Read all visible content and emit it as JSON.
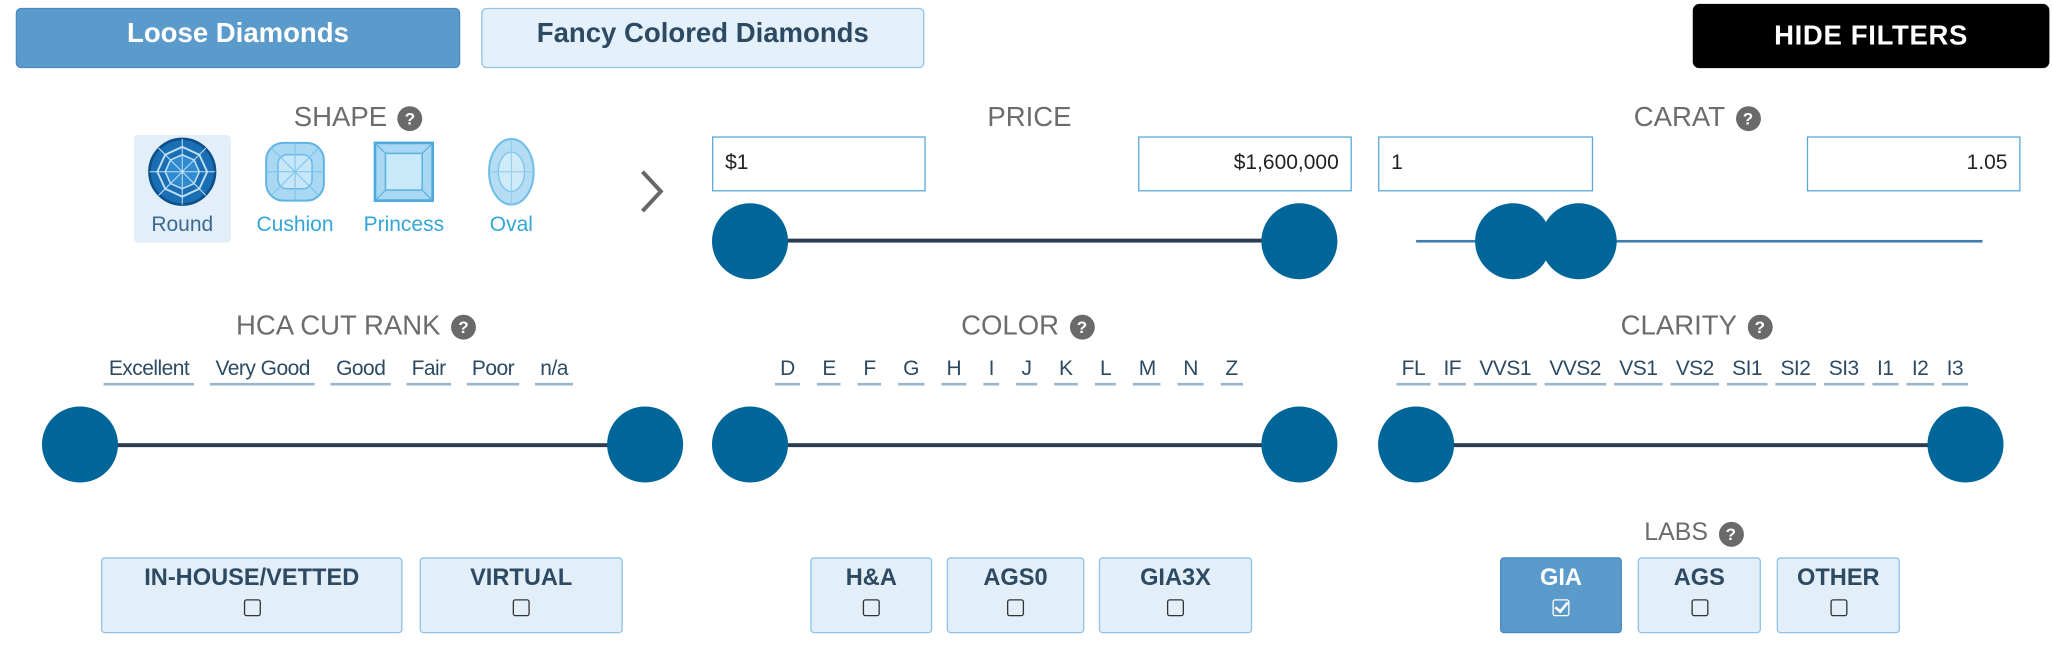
{
  "tabs": {
    "loose": "Loose Diamonds",
    "fancy": "Fancy Colored Diamonds",
    "hide_filters": "HIDE FILTERS"
  },
  "shape": {
    "title": "SHAPE",
    "help": "?",
    "items": [
      {
        "label": "Round",
        "selected": true
      },
      {
        "label": "Cushion",
        "selected": false
      },
      {
        "label": "Princess",
        "selected": false
      },
      {
        "label": "Oval",
        "selected": false
      }
    ]
  },
  "price": {
    "title": "PRICE",
    "min": "$1",
    "max": "$1,600,000"
  },
  "carat": {
    "title": "CARAT",
    "help": "?",
    "min": "1",
    "max": "1.05"
  },
  "cut": {
    "title": "HCA CUT RANK",
    "help": "?",
    "labels": [
      "Excellent",
      "Very Good",
      "Good",
      "Fair",
      "Poor",
      "n/a"
    ]
  },
  "color": {
    "title": "COLOR",
    "help": "?",
    "labels": [
      "D",
      "E",
      "F",
      "G",
      "H",
      "I",
      "J",
      "K",
      "L",
      "M",
      "N",
      "Z"
    ]
  },
  "clarity": {
    "title": "CLARITY",
    "help": "?",
    "labels": [
      "FL",
      "IF",
      "VVS1",
      "VVS2",
      "VS1",
      "VS2",
      "SI1",
      "SI2",
      "SI3",
      "I1",
      "I2",
      "I3"
    ]
  },
  "labs": {
    "title": "LABS",
    "help": "?"
  },
  "checks": {
    "inhouse": {
      "label": "IN-HOUSE/VETTED",
      "checked": false
    },
    "virtual": {
      "label": "VIRTUAL",
      "checked": false
    },
    "ha": {
      "label": "H&A",
      "checked": false
    },
    "ags0": {
      "label": "AGS0",
      "checked": false
    },
    "gia3x": {
      "label": "GIA3X",
      "checked": false
    },
    "gia": {
      "label": "GIA",
      "checked": true
    },
    "ags": {
      "label": "AGS",
      "checked": false
    },
    "other": {
      "label": "OTHER",
      "checked": false
    }
  },
  "colors": {
    "accent": "#006699",
    "tab_active": "#5b9bcc",
    "tab_inactive": "#e4f1fb",
    "dark_button": "#000000",
    "title_gray": "#6c6c6c"
  }
}
